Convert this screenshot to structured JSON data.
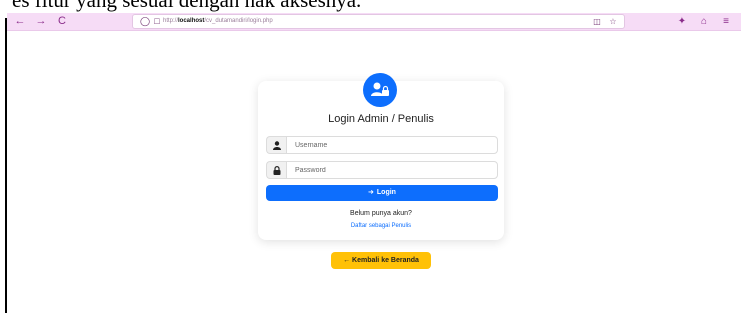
{
  "document": {
    "snippet": "es fitur yang sesuai dengan hak aksesnya."
  },
  "browser": {
    "back_icon": "←",
    "forward_icon": "→",
    "reload_icon": "C",
    "url_prefix": "http://",
    "url_host": "localhost",
    "url_path": "/cv_dutamandiri/login.php",
    "reader_icon": "reader-view-icon",
    "bookmark_icon": "star-icon"
  },
  "login": {
    "avatar_icon": "user-lock-icon",
    "title": "Login Admin / Penulis",
    "username_placeholder": "Username",
    "password_placeholder": "Password",
    "login_button": "Login",
    "no_account_text": "Belum punya akun?",
    "register_link": "Daftar sebagai Penulis"
  },
  "back_button": "Kembali ke Beranda",
  "colors": {
    "primary": "#0d6efd",
    "warning": "#ffc107",
    "toolbar": "#f6dcf6"
  }
}
